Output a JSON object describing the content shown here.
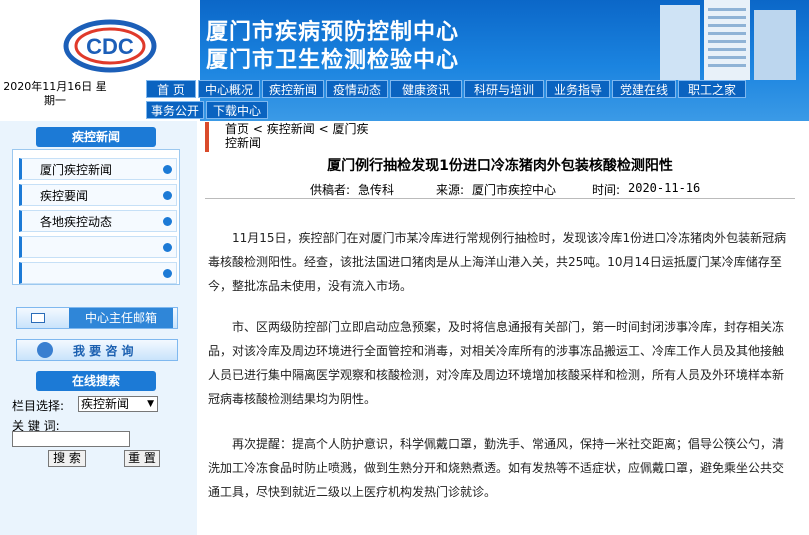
{
  "header": {
    "title_line1": "厦门市疾病预防控制中心",
    "title_line2": "厦门市卫生检测检验中心",
    "date_text": "2020年11月16日 星期一",
    "logo_letters": "CDC"
  },
  "nav": {
    "row1": [
      "首  页",
      "中心概况",
      "疾控新闻",
      "疫情动态",
      "健康资讯",
      "科研与培训",
      "业务指导",
      "党建在线",
      "职工之家"
    ],
    "row2": [
      "事务公开",
      "下载中心"
    ]
  },
  "sidebar": {
    "news_head": "疾控新闻",
    "items": [
      "厦门疾控新闻",
      "疾控要闻",
      "各地疾控动态",
      "",
      ""
    ],
    "mailbox_label": "中心主任邮箱",
    "consult_label": "我 要 咨 询",
    "search_head": "在线搜索",
    "column_label": "栏目选择:",
    "column_selected": "疾控新闻",
    "keyword_label": "关 键 词:",
    "keyword_value": "",
    "search_button": "搜 索",
    "reset_button": "重 置"
  },
  "breadcrumb": {
    "home": "首页",
    "level1": "疾控新闻",
    "level2": "厦门疾控新闻"
  },
  "article": {
    "title": "厦门例行抽检发现1份进口冷冻猪肉外包装核酸检测阳性",
    "provider_label": "供稿者:",
    "provider": "急传科",
    "source_label": "来源:",
    "source": "厦门市疾控中心",
    "time_label": "时间:",
    "time": "2020-11-16",
    "paragraphs": [
      "11月15日，疾控部门在对厦门市某冷库进行常规例行抽检时，发现该冷库1份进口冷冻猪肉外包装新冠病毒核酸检测阳性。经查，该批法国进口猪肉是从上海洋山港入关，共25吨。10月14日运抵厦门某冷库储存至今，整批冻品未使用，没有流入市场。",
      "市、区两级防控部门立即启动应急预案，及时将信息通报有关部门，第一时间封闭涉事冷库，封存相关冻品，对该冷库及周边环境进行全面管控和消毒，对相关冷库所有的涉事冻品搬运工、冷库工作人员及其他接触人员已进行集中隔离医学观察和核酸检测，对冷库及周边环境增加核酸采样和检测，所有人员及外环境样本新冠病毒核酸检测结果均为阴性。",
      "再次提醒：提高个人防护意识，科学佩戴口罩，勤洗手、常通风，保持一米社交距离；倡导公筷公勺，清洗加工冷冻食品时防止喷溅，做到生熟分开和烧熟煮透。如有发热等不适症状，应佩戴口罩，避免乘坐公共交通工具，尽快到就近二级以上医疗机构发热门诊就诊。"
    ]
  }
}
